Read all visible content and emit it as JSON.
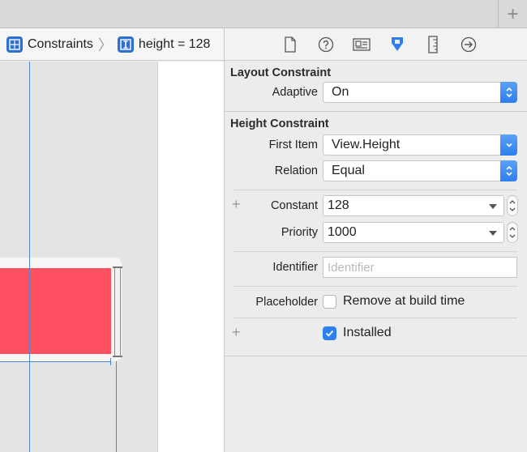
{
  "tabstrip": {
    "add_label": "+"
  },
  "breadcrumb": {
    "items": [
      {
        "icon": "constraints-group-icon",
        "label": "Constraints"
      },
      {
        "icon": "height-constraint-icon",
        "label": "height = 128"
      }
    ]
  },
  "inspector_tabs": [
    "file-inspector-icon",
    "quick-help-icon",
    "identity-inspector-icon",
    "attributes-inspector-icon",
    "size-inspector-icon",
    "connections-inspector-icon"
  ],
  "layout_constraint": {
    "title": "Layout Constraint",
    "adaptive_label": "Adaptive",
    "adaptive_value": "On"
  },
  "height_constraint": {
    "title": "Height Constraint",
    "first_item_label": "First Item",
    "first_item_value": "View.Height",
    "relation_label": "Relation",
    "relation_value": "Equal",
    "constant_label": "Constant",
    "constant_value": "128",
    "priority_label": "Priority",
    "priority_value": "1000",
    "identifier_label": "Identifier",
    "identifier_placeholder": "Identifier",
    "placeholder_label": "Placeholder",
    "placeholder_option": "Remove at build time",
    "placeholder_checked": false,
    "installed_label": "Installed",
    "installed_checked": true,
    "plus_symbol": "+"
  },
  "colors": {
    "accent": "#2d7ef0",
    "view_fill": "#ff5061",
    "guide": "#4d86c9"
  }
}
